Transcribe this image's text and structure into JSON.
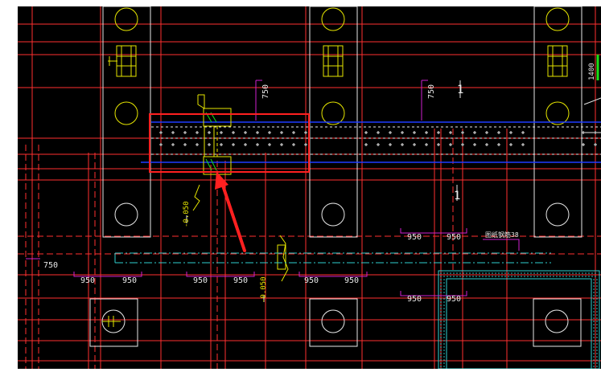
{
  "drawing": {
    "background_color": "#000000",
    "colors": {
      "axis_red": "#ff3030",
      "outline_white": "#e8e8e8",
      "yellow": "#e6e600",
      "blue": "#1f3cff",
      "cyan": "#2fd0d0",
      "magenta": "#d020d0",
      "green": "#18e018",
      "highlight_red": "#ff2020"
    },
    "dimensions": {
      "d750_left": "750",
      "d750_top_a": "750",
      "d750_top_b": "750",
      "d950": "950",
      "d1400": "1400",
      "elev_a": "-0.050",
      "elev_b": "-0.050",
      "marker_1": "1",
      "marker_2": "1"
    },
    "labels": {
      "note_right": "图纸钢筋38"
    }
  },
  "annotations": {
    "highlight_box": "selected-beam-region",
    "arrow": "pointer-arrow"
  }
}
